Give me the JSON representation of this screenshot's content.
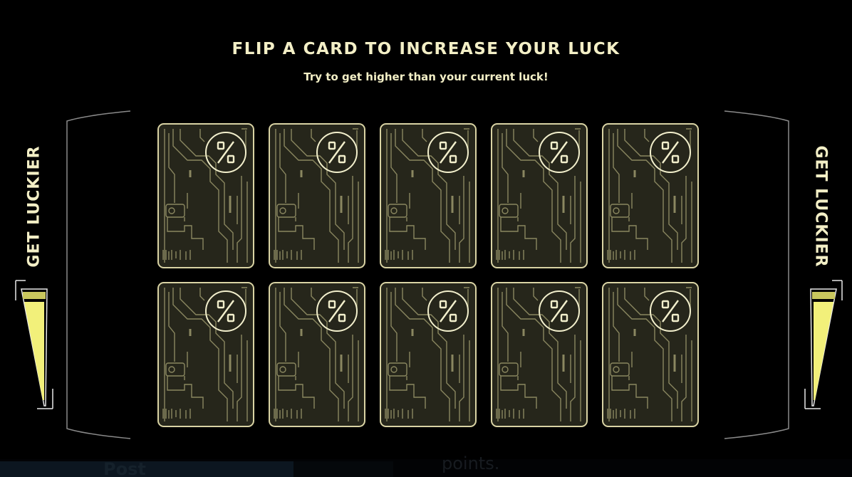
{
  "header": {
    "title": "FLIP A CARD TO INCREASE YOUR LUCK",
    "subtitle": "Try to get higher than your current luck!"
  },
  "side_labels": {
    "left": "GET LUCKIER",
    "right": "GET LUCKIER"
  },
  "meters": {
    "left_fill": 0.9,
    "right_fill": 0.9,
    "fill_color": "#f2f07a"
  },
  "cards": [
    {
      "face": "%"
    },
    {
      "face": "%"
    },
    {
      "face": "%"
    },
    {
      "face": "%"
    },
    {
      "face": "%"
    },
    {
      "face": "%"
    },
    {
      "face": "%"
    },
    {
      "face": "%"
    },
    {
      "face": "%"
    },
    {
      "face": "%"
    }
  ],
  "background_peek": {
    "left_text": "Post",
    "right_text": "points."
  },
  "colors": {
    "background": "#000000",
    "text": "#f3efc6",
    "card_fill": "#26261b",
    "card_border": "#d9d3a4",
    "circuit": "#8a8760"
  },
  "icons": {
    "card_badge": "percent-icon"
  }
}
